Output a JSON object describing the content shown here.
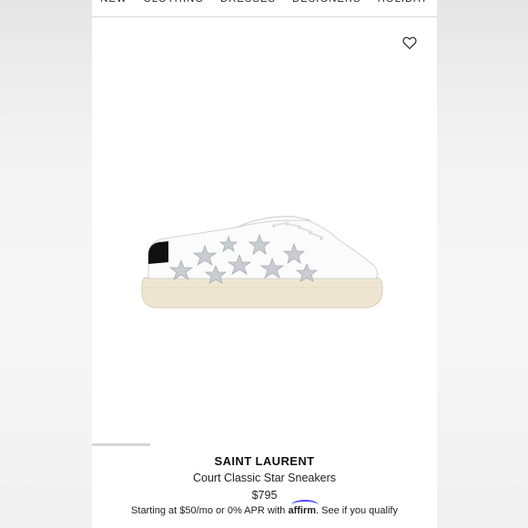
{
  "nav": {
    "items": [
      "NEW",
      "CLOTHING",
      "DRESSES",
      "DESIGNERS",
      "HOLIDAY"
    ]
  },
  "product": {
    "brand": "SAINT LAURENT",
    "name": "Court Classic Star Sneakers",
    "price": "$795",
    "financing": {
      "prefix": "Starting at $50/mo or 0% APR with",
      "affirm_logo": "affirm",
      "suffix": ".",
      "link": "See if you qualify"
    }
  },
  "icons": {
    "wishlist": "heart-icon"
  },
  "colors": {
    "affirm_accent": "#4a4aff",
    "sole": "#efe6d2",
    "star_silver": "#c9cdd2"
  }
}
